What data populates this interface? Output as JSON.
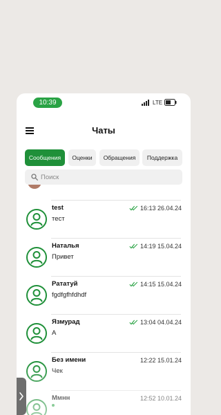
{
  "status_bar": {
    "time": "10:39",
    "network": "LTE"
  },
  "header": {
    "title": "Чаты",
    "menu_icon": "hamburger-menu-icon"
  },
  "tabs": [
    {
      "label": "Сообщения",
      "active": true
    },
    {
      "label": "Оценки",
      "active": false
    },
    {
      "label": "Обращения",
      "active": false
    },
    {
      "label": "Поддержка",
      "active": false
    }
  ],
  "search": {
    "placeholder": "Поиск",
    "value": ""
  },
  "chats": [
    {
      "name": "test",
      "preview": "тест",
      "time": "16:13 26.04.24",
      "read": true
    },
    {
      "name": "Наталья",
      "preview": "Привет",
      "time": "14:19 15.04.24",
      "read": true
    },
    {
      "name": "Рататуй",
      "preview": "fgdfgfhfdhdf",
      "time": "14:15 15.04.24",
      "read": true
    },
    {
      "name": "Язмурад",
      "preview": "А",
      "time": "13:04 04.04.24",
      "read": true
    },
    {
      "name": "Без имени",
      "preview": "Чек",
      "time": "12:22 15.01.24",
      "read": false
    },
    {
      "name": "Ммнн",
      "preview": "",
      "time": "12:52 10.01.24",
      "read": false,
      "unread_dot": true
    }
  ],
  "colors": {
    "accent": "#1f9039",
    "accent_light": "#2aa345",
    "background": "#ece9e6"
  }
}
